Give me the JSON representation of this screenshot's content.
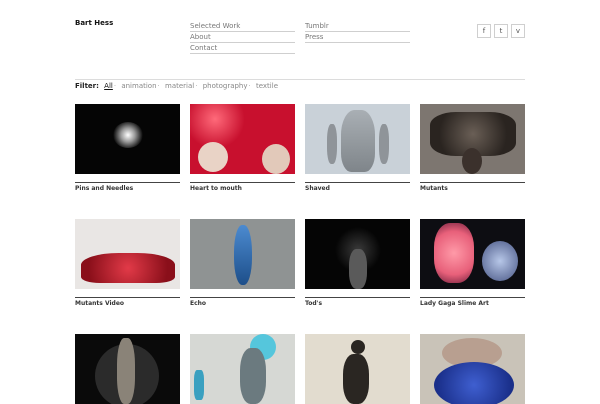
{
  "site": {
    "title": "Bart Hess"
  },
  "nav": {
    "col1": [
      "Selected Work",
      "About",
      "Contact"
    ],
    "col2": [
      "Tumblr",
      "Press"
    ]
  },
  "social": [
    {
      "glyph": "f",
      "icon": "facebook-icon"
    },
    {
      "glyph": "t",
      "icon": "twitter-icon"
    },
    {
      "glyph": "v",
      "icon": "vimeo-icon"
    }
  ],
  "filter": {
    "label": "Filter:",
    "items": [
      "All",
      "animation",
      "material",
      "photography",
      "textile"
    ],
    "active": "All",
    "separator": "·"
  },
  "works": [
    {
      "title": "Pins and Needles",
      "bg": "#050505",
      "accent": "#d8d8d8"
    },
    {
      "title": "Heart to mouth",
      "bg": "#c8102e",
      "accent": "#ead7cc"
    },
    {
      "title": "Shaved",
      "bg": "#c9d1d8",
      "accent": "#8a8f94"
    },
    {
      "title": "Mutants",
      "bg": "#7d7670",
      "accent": "#2a2420"
    },
    {
      "title": "Mutants Video",
      "bg": "#e9e6e4",
      "accent": "#b01a25"
    },
    {
      "title": "Echo",
      "bg": "#8f9393",
      "accent": "#2a6db0"
    },
    {
      "title": "Tod's",
      "bg": "#050505",
      "accent": "#6a6a6a"
    },
    {
      "title": "Lady Gaga Slime Art",
      "bg": "#0d0d12",
      "accent": "#e8607a"
    },
    {
      "title": "",
      "bg": "#0a0a0a",
      "accent": "#8a8378"
    },
    {
      "title": "",
      "bg": "#d6d8d4",
      "accent": "#3ab0c8"
    },
    {
      "title": "",
      "bg": "#e2dccf",
      "accent": "#2a2622"
    },
    {
      "title": "",
      "bg": "#c9c3b8",
      "accent": "#1f3fa6"
    }
  ]
}
